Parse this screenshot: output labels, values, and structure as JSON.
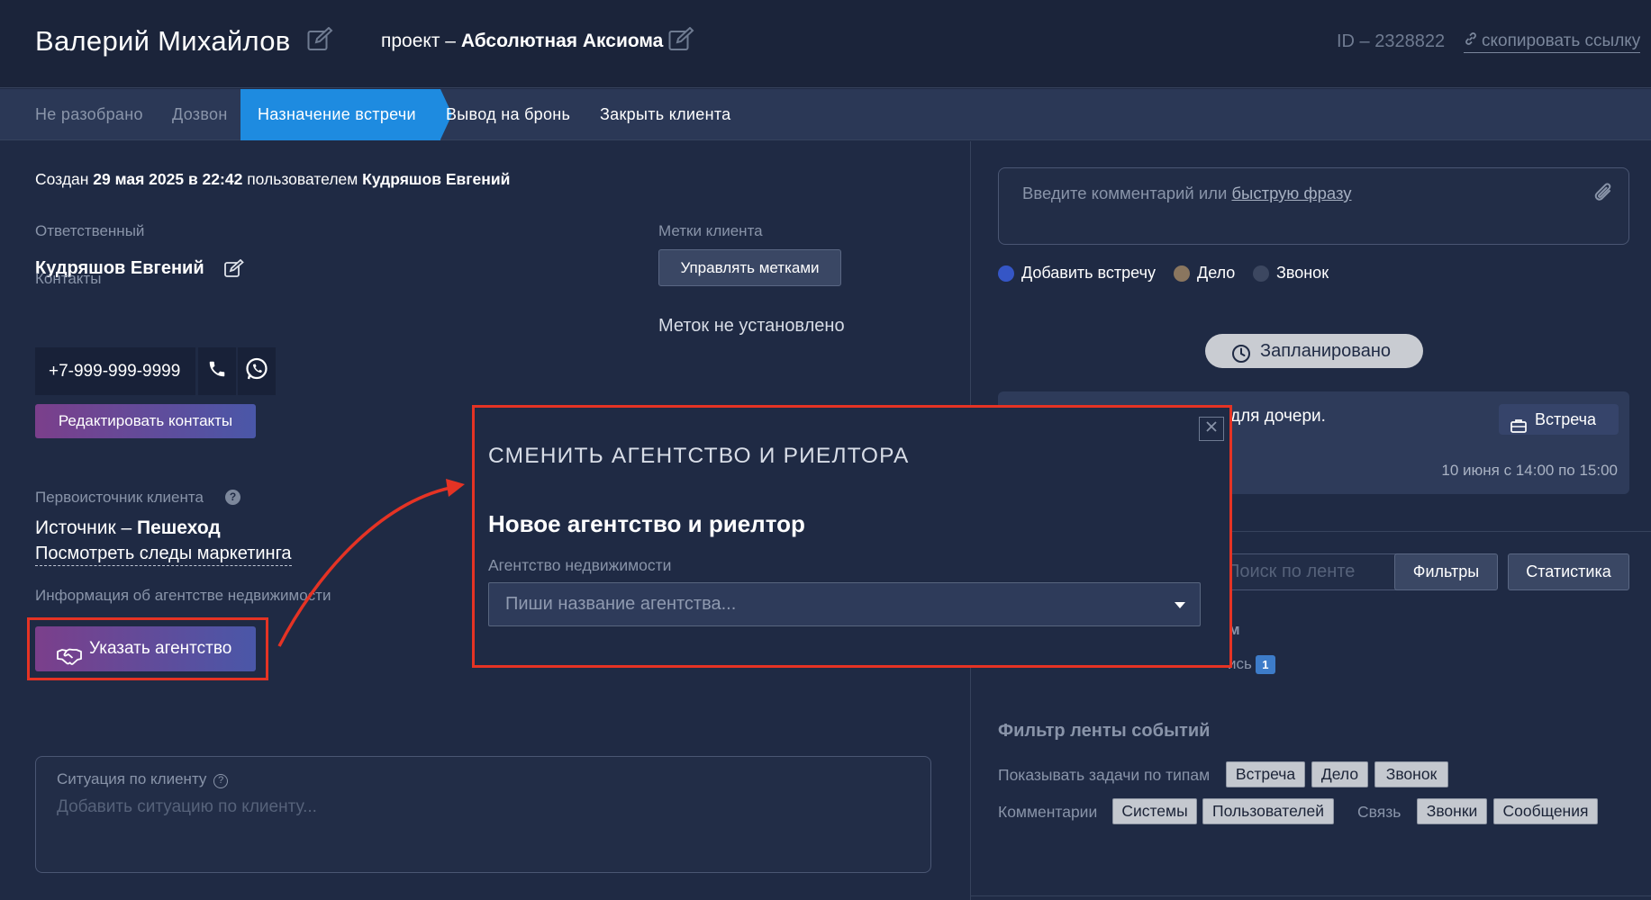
{
  "header": {
    "client_name": "Валерий Михайлов",
    "project_prefix": "проект – ",
    "project_name": "Абсолютная Аксиома",
    "client_id": "ID – 2328822",
    "copy_link": "скопировать ссылку"
  },
  "stages": [
    {
      "label": "Не разобрано",
      "state": "done"
    },
    {
      "label": "Дозвон",
      "state": "done"
    },
    {
      "label": "Назначение встречи",
      "state": "active"
    },
    {
      "label": "Вывод на бронь",
      "state": "next"
    },
    {
      "label": "Закрыть клиента",
      "state": "next"
    }
  ],
  "created": {
    "prefix": "Создан ",
    "date": "29 мая 2025 в 22:42",
    "middle": " пользователем ",
    "user": "Кудряшов Евгений"
  },
  "responsible": {
    "label": "Ответственный",
    "name": "Кудряшов Евгений"
  },
  "contacts": {
    "label": "Контакты",
    "phone": "+7-999-999-9999",
    "edit_button": "Редактировать контакты"
  },
  "tags": {
    "label": "Метки клиента",
    "manage_button": "Управлять метками",
    "empty_text": "Меток не установлено"
  },
  "source": {
    "label": "Первоисточник клиента",
    "prefix": "Источник – ",
    "value": "Пешеход",
    "marketing_link": "Посмотреть следы маркетинга"
  },
  "agency": {
    "label": "Информация об агентстве недвижимости",
    "button": "Указать агентство"
  },
  "situation": {
    "label": "Ситуация по клиенту",
    "help": "?",
    "placeholder": "Добавить ситуацию по клиенту..."
  },
  "comment": {
    "placeholder_prefix": "Введите комментарий или ",
    "placeholder_link": "быструю фразу"
  },
  "event_types": [
    {
      "label": "Добавить встречу",
      "color": "#3556c6"
    },
    {
      "label": "Дело",
      "color": "#8a765f"
    },
    {
      "label": "Звонок",
      "color": "#3c4760"
    }
  ],
  "planned_button": "Запланировано",
  "event": {
    "text": "для дочери.",
    "badge": "Встреча",
    "time": "10 июня с 14:00 по 15:00"
  },
  "feed": {
    "search_placeholder": "Поиск по ленте",
    "filters_button": "Фильтры",
    "stats_button": "Статистика",
    "partial_heading": "м",
    "partial_line": "ись",
    "partial_count": "1"
  },
  "feed_filter": {
    "title": "Фильтр ленты событий",
    "task_types_label": "Показывать задачи по типам",
    "task_types": [
      "Встреча",
      "Дело",
      "Звонок"
    ],
    "comments_label": "Комментарии",
    "comments": [
      "Системы",
      "Пользователей"
    ],
    "link_label": "Связь",
    "links": [
      "Звонки",
      "Сообщения"
    ]
  },
  "modal": {
    "title": "СМЕНИТЬ АГЕНТСТВО И РИЕЛТОРА",
    "subtitle": "Новое агентство и риелтор",
    "field_label": "Агентство недвижимости",
    "field_placeholder": "Пиши название агентства..."
  },
  "colors": {
    "background": "#1f2a44",
    "active_stage": "#1e8be0",
    "highlight": "#e53324",
    "gradient_button_start": "#7b3f8b",
    "gradient_button_end": "#4a57a8"
  },
  "icons": [
    "edit-icon",
    "link-icon",
    "phone-icon",
    "whatsapp-icon",
    "help-icon",
    "handshake-icon",
    "paperclip-icon",
    "clock-icon",
    "briefcase-icon",
    "close-icon",
    "caret-down-icon"
  ]
}
